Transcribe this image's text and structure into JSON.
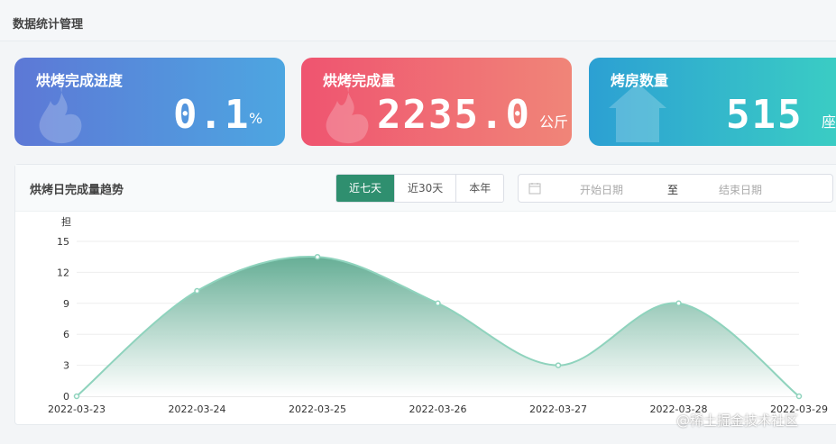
{
  "header": {
    "title": "数据统计管理"
  },
  "cards": [
    {
      "title": "烘烤完成进度",
      "value": "0.1",
      "unit": "%"
    },
    {
      "title": "烘烤完成量",
      "value": "2235.0",
      "unit": "公斤"
    },
    {
      "title": "烤房数量",
      "value": "515",
      "unit": "座"
    }
  ],
  "trend": {
    "title": "烘烤日完成量趋势",
    "tabs": [
      "近七天",
      "近30天",
      "本年"
    ],
    "active_tab": "近七天",
    "date_range": {
      "start_placeholder": "开始日期",
      "separator": "至",
      "end_placeholder": "结束日期"
    }
  },
  "chart_data": {
    "type": "area",
    "ylabel": "担",
    "yticks": [
      0,
      3,
      6,
      9,
      12,
      15
    ],
    "ylim": [
      0,
      15
    ],
    "categories": [
      "2022-03-23",
      "2022-03-24",
      "2022-03-25",
      "2022-03-26",
      "2022-03-27",
      "2022-03-28",
      "2022-03-29"
    ],
    "values": [
      0,
      10.2,
      13.5,
      9.0,
      3.0,
      9.0,
      0
    ],
    "grid": true,
    "colors": {
      "line": "#8fd3bd",
      "fill_top": "#5eaa90",
      "fill_bottom": "#ffffff"
    }
  },
  "watermark": "@稀土掘金技术社区"
}
